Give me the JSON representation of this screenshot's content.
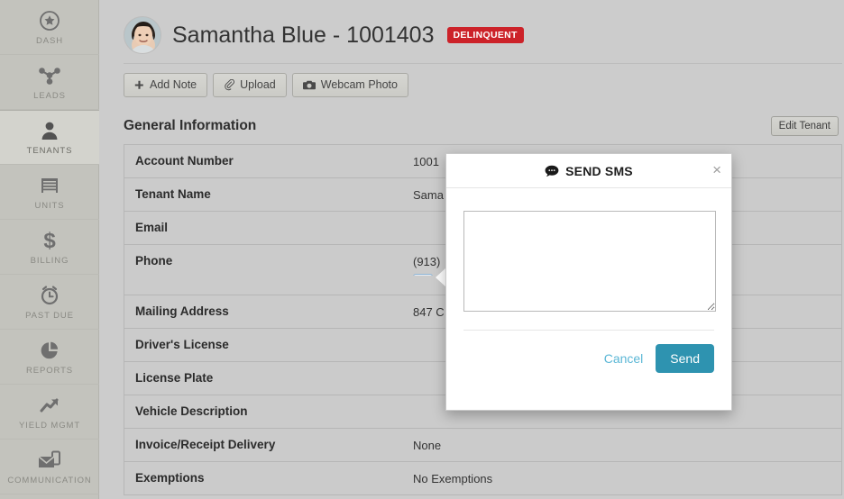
{
  "sidebar": {
    "items": [
      {
        "label": "DASH",
        "icon": "star-circle-icon",
        "active": false
      },
      {
        "label": "LEADS",
        "icon": "network-nodes-icon",
        "active": false
      },
      {
        "label": "TENANTS",
        "icon": "person-icon",
        "active": true
      },
      {
        "label": "UNITS",
        "icon": "storage-door-icon",
        "active": false
      },
      {
        "label": "BILLING",
        "icon": "dollar-sign-icon",
        "active": false
      },
      {
        "label": "PAST DUE",
        "icon": "alarm-clock-icon",
        "active": false
      },
      {
        "label": "REPORTS",
        "icon": "pie-chart-icon",
        "active": false
      },
      {
        "label": "YIELD MGMT",
        "icon": "trend-up-arrow-icon",
        "active": false
      },
      {
        "label": "COMMUNICATION",
        "icon": "envelope-phone-icon",
        "active": false
      }
    ]
  },
  "header": {
    "tenant_name": "Samantha Blue - 1001403",
    "badge": "DELINQUENT",
    "badge_color": "#cc2229",
    "avatar_alt": "tenant-avatar"
  },
  "actions": [
    {
      "label": "Add Note",
      "icon": "plus-icon"
    },
    {
      "label": "Upload",
      "icon": "paperclip-icon"
    },
    {
      "label": "Webcam Photo",
      "icon": "camera-icon"
    }
  ],
  "section": {
    "title": "General Information",
    "edit_button": "Edit Tenant"
  },
  "table": {
    "rows": [
      {
        "label": "Account Number",
        "value": "1001",
        "truncated": true
      },
      {
        "label": "Tenant Name",
        "value": "Sama",
        "truncated": true
      },
      {
        "label": "Email",
        "value": ""
      },
      {
        "label": "Phone",
        "value": "(913)",
        "truncated": true,
        "has_sms_button": true,
        "sms_icon": "sms-bubble-icon"
      },
      {
        "label": "Mailing Address",
        "value": "847 C",
        "truncated": true
      },
      {
        "label": "Driver's License",
        "value": ""
      },
      {
        "label": "License Plate",
        "value": ""
      },
      {
        "label": "Vehicle Description",
        "value": ""
      },
      {
        "label": "Invoice/Receipt Delivery",
        "value": "None"
      },
      {
        "label": "Exemptions",
        "value": "No Exemptions"
      }
    ]
  },
  "modal": {
    "title": "SEND SMS",
    "title_icon": "sms-bubble-icon",
    "close_label": "×",
    "message_value": "",
    "message_placeholder": "",
    "cancel_label": "Cancel",
    "send_label": "Send",
    "send_color": "#2e93b0",
    "cancel_color": "#5bb7d6"
  }
}
